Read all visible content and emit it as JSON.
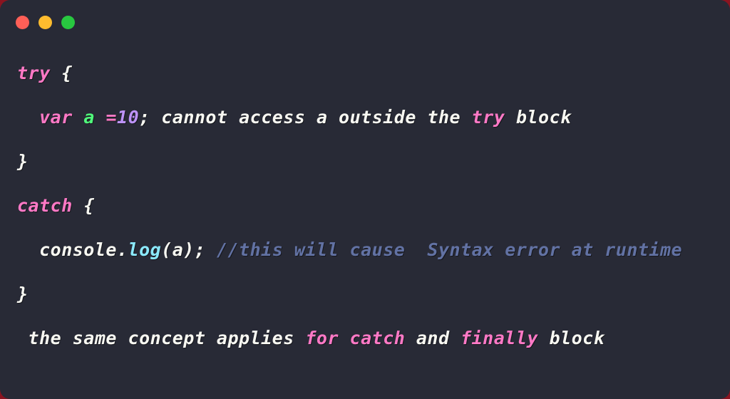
{
  "window": {
    "theme_name": "dracula",
    "background_color": "#282a36",
    "backdrop_color": "#8a1420",
    "controls": [
      {
        "name": "close",
        "color": "#ff5f57"
      },
      {
        "name": "minimize",
        "color": "#febc2e"
      },
      {
        "name": "maximize",
        "color": "#28c840"
      }
    ]
  },
  "palette": {
    "foreground": "#f8f8f2",
    "keyword": "#ff79c6",
    "variable": "#50fa7b",
    "number": "#bd93f9",
    "function": "#8be9fd",
    "comment": "#6272a4"
  },
  "code": {
    "language": "javascript",
    "lines": [
      {
        "id": "line-try-open",
        "tokens": [
          {
            "text": "try",
            "type": "keyword"
          },
          {
            "text": " {",
            "type": "plain"
          }
        ]
      },
      {
        "id": "line-var-decl",
        "tokens": [
          {
            "text": "  ",
            "type": "plain"
          },
          {
            "text": "var",
            "type": "keyword"
          },
          {
            "text": " ",
            "type": "plain"
          },
          {
            "text": "a",
            "type": "variable"
          },
          {
            "text": " ",
            "type": "plain"
          },
          {
            "text": "=",
            "type": "keyword"
          },
          {
            "text": "10",
            "type": "number"
          },
          {
            "text": "; cannot access a outside the ",
            "type": "plain"
          },
          {
            "text": "try",
            "type": "keyword"
          },
          {
            "text": " block",
            "type": "plain"
          }
        ]
      },
      {
        "id": "line-try-close",
        "tokens": [
          {
            "text": "}",
            "type": "plain"
          }
        ]
      },
      {
        "id": "line-catch-open",
        "tokens": [
          {
            "text": "catch",
            "type": "keyword"
          },
          {
            "text": " {",
            "type": "plain"
          }
        ]
      },
      {
        "id": "line-console-log",
        "tokens": [
          {
            "text": "  console.",
            "type": "plain"
          },
          {
            "text": "log",
            "type": "function"
          },
          {
            "text": "(a); ",
            "type": "plain"
          },
          {
            "text": "//this will cause  Syntax error at runtime",
            "type": "comment"
          }
        ]
      },
      {
        "id": "line-catch-close",
        "tokens": [
          {
            "text": "}",
            "type": "plain"
          }
        ]
      },
      {
        "id": "line-note",
        "tokens": [
          {
            "text": " the same concept applies ",
            "type": "plain"
          },
          {
            "text": "for catch",
            "type": "keyword"
          },
          {
            "text": " and ",
            "type": "plain"
          },
          {
            "text": "finally",
            "type": "keyword"
          },
          {
            "text": " block",
            "type": "plain"
          }
        ]
      }
    ]
  }
}
